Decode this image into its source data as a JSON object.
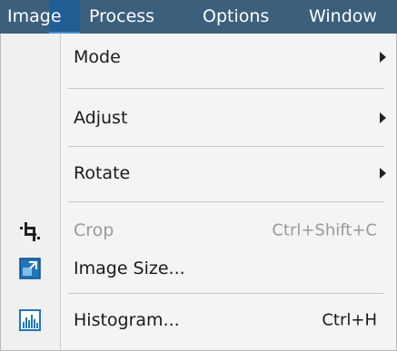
{
  "menubar": {
    "items": [
      {
        "label": "Image"
      },
      {
        "label": "Process"
      },
      {
        "label": "Options"
      },
      {
        "label": "Window"
      }
    ]
  },
  "dropdown": {
    "items": [
      {
        "label": "Mode",
        "has_submenu": true
      },
      {
        "label": "Adjust",
        "has_submenu": true
      },
      {
        "label": "Rotate",
        "has_submenu": true
      },
      {
        "label": "Crop",
        "shortcut": "Ctrl+Shift+C",
        "enabled": false,
        "icon": "crop-icon"
      },
      {
        "label": "Image Size...",
        "icon": "image-size-icon"
      },
      {
        "label": "Histogram...",
        "shortcut": "Ctrl+H",
        "icon": "histogram-icon"
      }
    ]
  },
  "colors": {
    "menubar_bg": "#3c5f7c",
    "selected_bg": "#205e93",
    "dropdown_bg": "#f4f4f4",
    "disabled_text": "#9a9a9a",
    "icon_blue": "#1a6fb5"
  }
}
